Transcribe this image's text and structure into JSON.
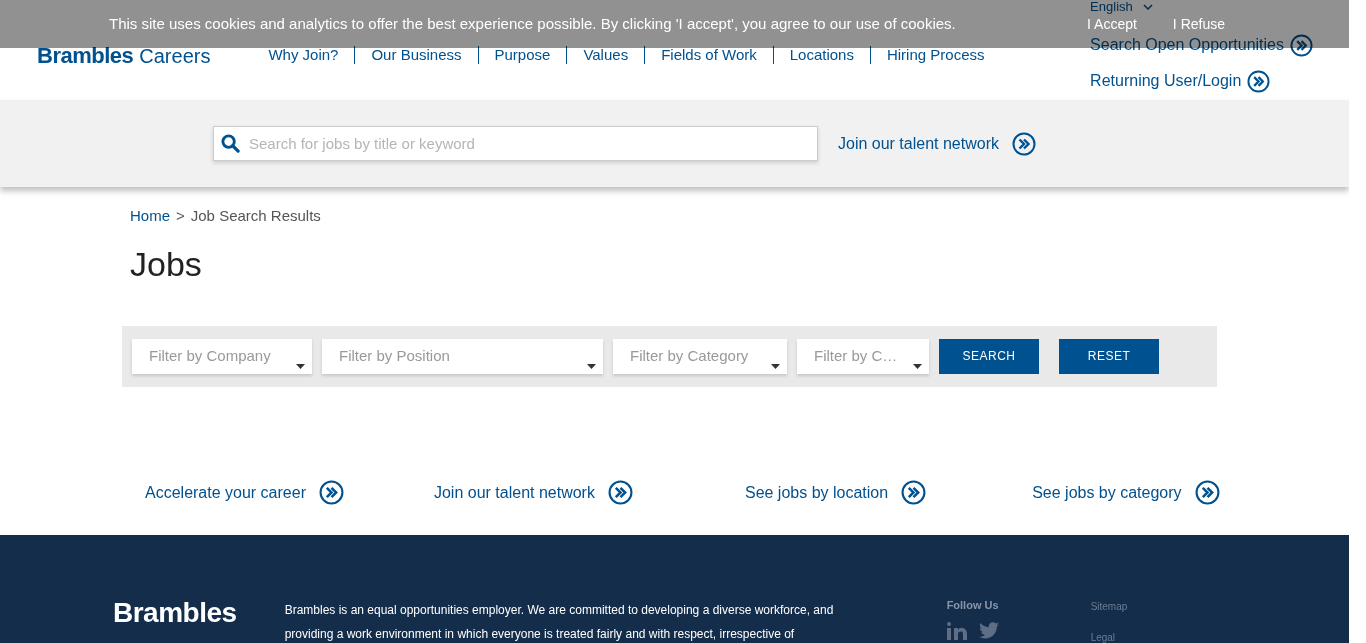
{
  "cookie_banner": {
    "message": "This site uses cookies and analytics to offer the best experience possible. By clicking 'I accept', you agree to our use of cookies.",
    "buttons": [
      "I Accept",
      "I Refuse"
    ]
  },
  "header": {
    "logo": {
      "brand": "Brambles",
      "suffix": "Careers"
    },
    "nav": [
      "Why Join?",
      "Our Business",
      "Purpose",
      "Values",
      "Fields of Work",
      "Locations",
      "Hiring Process"
    ],
    "language": "English",
    "links": [
      "Search Open Opportunities",
      "Returning User/Login"
    ]
  },
  "search": {
    "placeholder": "Search for jobs by title or keyword",
    "talent_link": "Join our talent network"
  },
  "breadcrumb": [
    {
      "label": "Home",
      "current": false
    },
    {
      "label": "Job Search Results",
      "current": true
    }
  ],
  "breadcrumb_separator": ">",
  "page_title": "Jobs",
  "filters": [
    {
      "placeholder": "Filter by Company"
    },
    {
      "placeholder": "Filter by Position"
    },
    {
      "placeholder": "Filter by Category"
    },
    {
      "placeholder": "Filter by C…"
    }
  ],
  "filter_buttons": [
    "SEARCH",
    "RESET"
  ],
  "quick_links": [
    "Accelerate your career",
    "Join our talent network",
    "See jobs by location",
    "See jobs by category"
  ],
  "footer": {
    "logo": "Brambles",
    "text": "Brambles is an equal opportunities employer. We are committed to developing a diverse workforce, and providing a work environment in which everyone is treated fairly and with respect, irrespective of",
    "follow_label": "Follow Us",
    "links": [
      "Sitemap",
      "Legal"
    ]
  }
}
